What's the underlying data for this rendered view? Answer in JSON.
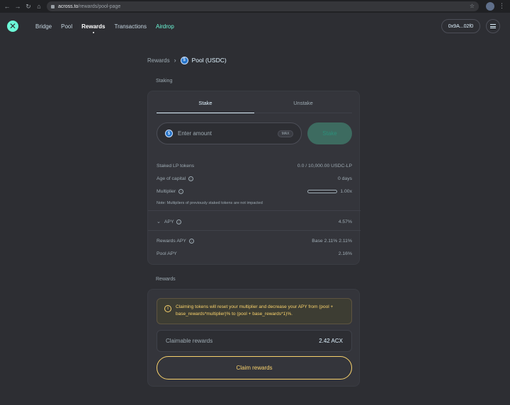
{
  "browser": {
    "url_host": "across.to",
    "url_path": "/rewards/pool-page"
  },
  "header": {
    "nav": [
      {
        "label": "Bridge",
        "active": false
      },
      {
        "label": "Pool",
        "active": false
      },
      {
        "label": "Rewards",
        "active": true
      },
      {
        "label": "Transactions",
        "active": false
      },
      {
        "label": "Airdrop",
        "active": false
      }
    ],
    "wallet_address": "0x9A...02f0"
  },
  "breadcrumb": {
    "parent": "Rewards",
    "current": "Pool (USDC)"
  },
  "staking": {
    "section_label": "Staking",
    "tabs": [
      "Stake",
      "Unstake"
    ],
    "amount_placeholder": "Enter amount",
    "max_label": "MAX",
    "stake_button": "Stake",
    "staked_lp": {
      "label": "Staked LP tokens",
      "value": "0.0 / 10,000.00 USDC-LP"
    },
    "age": {
      "label": "Age of capital",
      "value": "0 days"
    },
    "multiplier": {
      "label": "Multiplier",
      "value": "1.00x",
      "fill": 0
    },
    "note": "Note: Multipliers of previously staked tokens are not impacted",
    "apy": {
      "label": "APY",
      "value": "4.57%"
    },
    "rewards_apy": {
      "label": "Rewards APY",
      "value": "Base 2.11%  2.11%"
    },
    "pool_apy": {
      "label": "Pool APY",
      "value": "2.16%"
    }
  },
  "rewards": {
    "section_label": "Rewards",
    "warning_text": "Claiming tokens will reset your multiplier and decrease your APY from (pool + base_rewards*multiplier)% to (pool + base_rewards*1)%.",
    "claimable_label": "Claimable rewards",
    "claimable_value": "2.42 ACX",
    "claim_button": "Claim rewards"
  },
  "colors": {
    "accent": "#6cf9d8",
    "warning": "#f9d26c",
    "background": "#2d2e33"
  }
}
